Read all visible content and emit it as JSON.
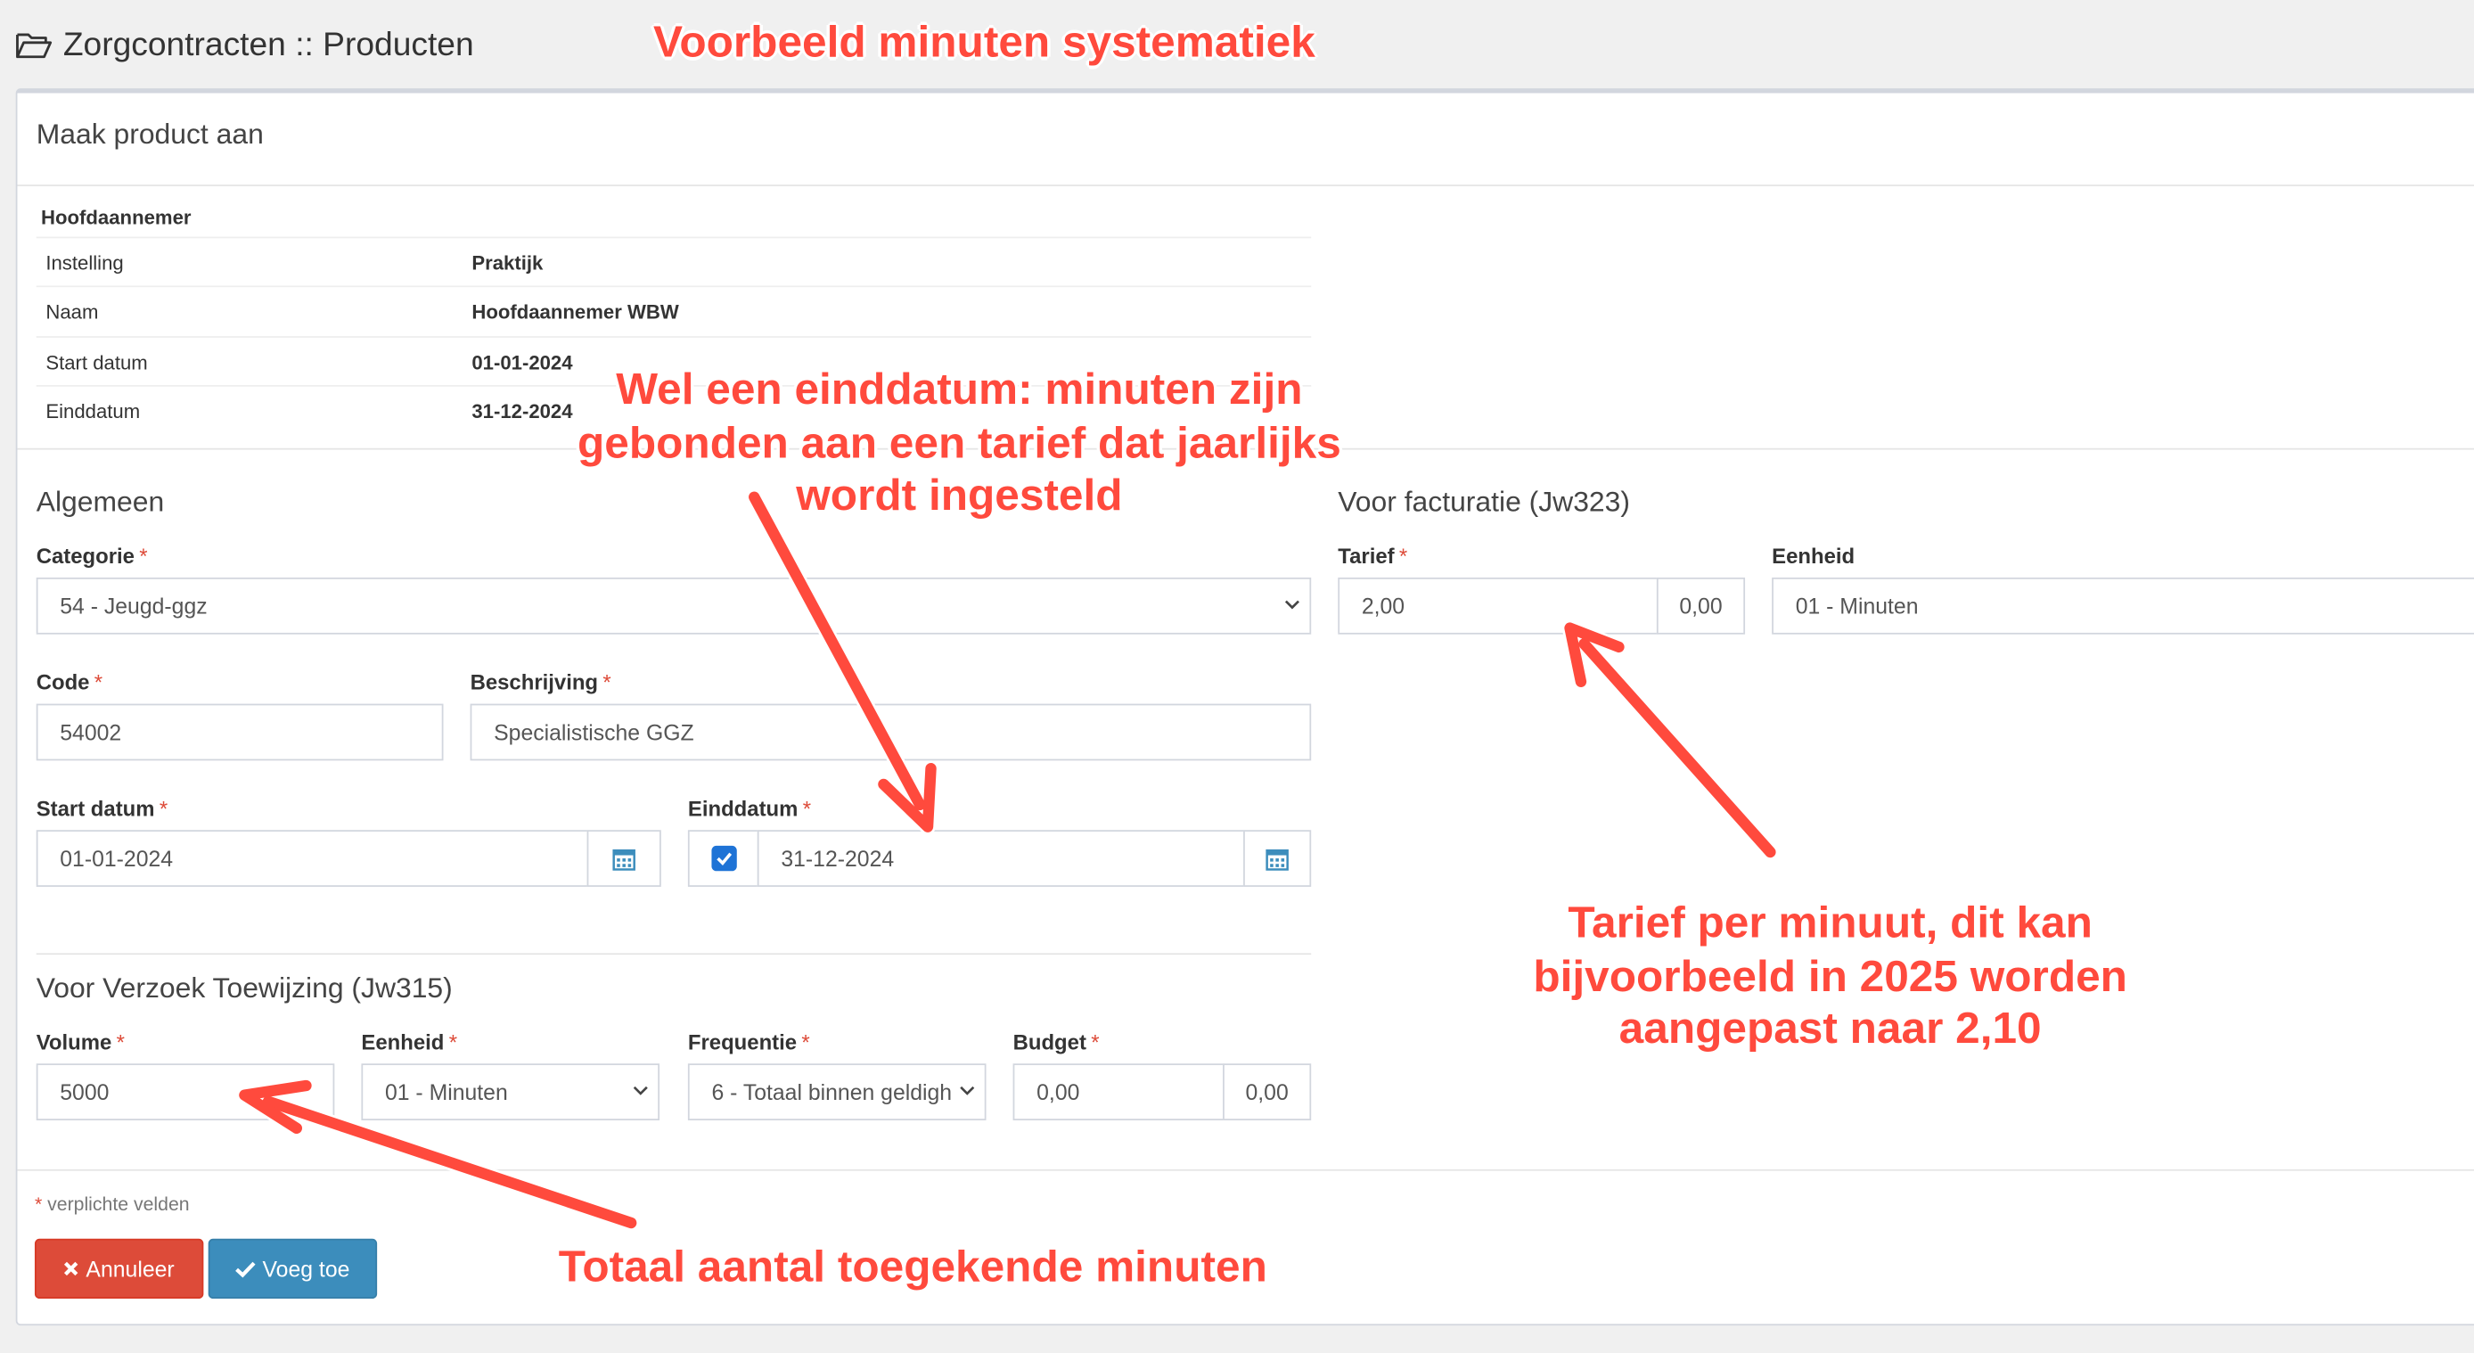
{
  "header": {
    "title": "Zorgcontracten :: Producten"
  },
  "box": {
    "title": "Maak product aan"
  },
  "info": {
    "heading": "Hoofdaannemer",
    "rows": [
      {
        "label": "Instelling",
        "value": "Praktijk"
      },
      {
        "label": "Naam",
        "value": "Hoofdaannemer WBW"
      },
      {
        "label": "Start datum",
        "value": "01-01-2024"
      },
      {
        "label": "Einddatum",
        "value": "31-12-2024"
      }
    ]
  },
  "algemeen": {
    "title": "Algemeen",
    "categorie": {
      "label": "Categorie",
      "value": "54 - Jeugd-ggz"
    },
    "code": {
      "label": "Code",
      "value": "54002"
    },
    "beschrijving": {
      "label": "Beschrijving",
      "value": "Specialistische GGZ"
    },
    "start": {
      "label": "Start datum",
      "value": "01-01-2024"
    },
    "eind": {
      "label": "Einddatum",
      "value": "31-12-2024",
      "checked": true
    }
  },
  "toewijzing": {
    "title": "Voor Verzoek Toewijzing (Jw315)",
    "volume": {
      "label": "Volume",
      "value": "5000"
    },
    "eenheid": {
      "label": "Eenheid",
      "value": "01 - Minuten"
    },
    "frequentie": {
      "label": "Frequentie",
      "value": "6 - Totaal binnen geldigh"
    },
    "budget": {
      "label": "Budget",
      "value": "0,00",
      "addon": "0,00"
    }
  },
  "facturatie": {
    "title": "Voor facturatie (Jw323)",
    "tarief": {
      "label": "Tarief",
      "value": "2,00",
      "addon": "0,00"
    },
    "eenheid": {
      "label": "Eenheid",
      "value": "01 - Minuten"
    }
  },
  "required_star": "*",
  "required_note": "verplichte velden",
  "buttons": {
    "cancel": "Annuleer",
    "add": "Voeg toe"
  },
  "annotations": {
    "title": "Voorbeeld minuten systematiek",
    "einddatum": [
      "Wel een einddatum: minuten zijn",
      "gebonden aan een tarief dat jaarlijks",
      "wordt ingesteld"
    ],
    "tarief": [
      "Tarief per minuut, dit kan",
      "bijvoorbeeld in 2025 worden",
      "aangepast naar 2,10"
    ],
    "volume": "Totaal aantal toegekende minuten"
  },
  "colors": {
    "danger": "#dd4b39",
    "primary": "#3c8dbc",
    "annotation": "#ff4a3d",
    "checkbox": "#1e73d6"
  }
}
